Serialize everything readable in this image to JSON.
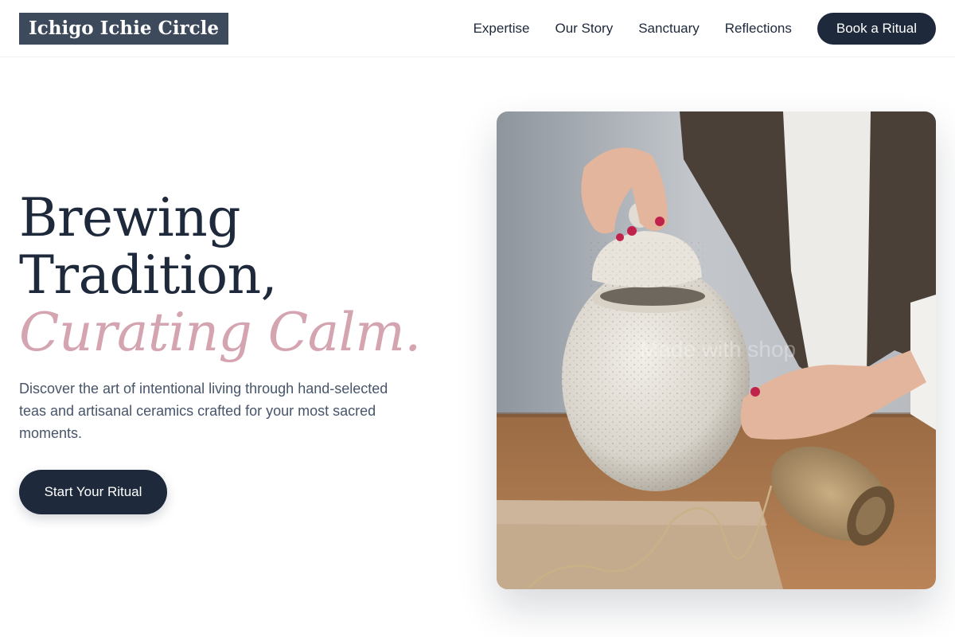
{
  "brand": {
    "name": "Ichigo Ichie Circle"
  },
  "nav": {
    "items": [
      "Expertise",
      "Our Story",
      "Sanctuary",
      "Reflections"
    ],
    "cta_label": "Book a Ritual"
  },
  "hero": {
    "title_line1": "Brewing",
    "title_line2": "Tradition,",
    "title_accent": "Curating Calm.",
    "subtitle": "Discover the art of intentional living through hand-selected teas and artisanal ceramics crafted for your most sacred moments.",
    "cta_label": "Start Your Ritual",
    "image": {
      "description_icon": "ceramic-jar-photo",
      "watermark": "Made with shop"
    }
  },
  "colors": {
    "primary": "#1e293b",
    "accent": "#d4a5b1",
    "logo_bg": "#3d4a5c",
    "body_text": "#475569"
  }
}
